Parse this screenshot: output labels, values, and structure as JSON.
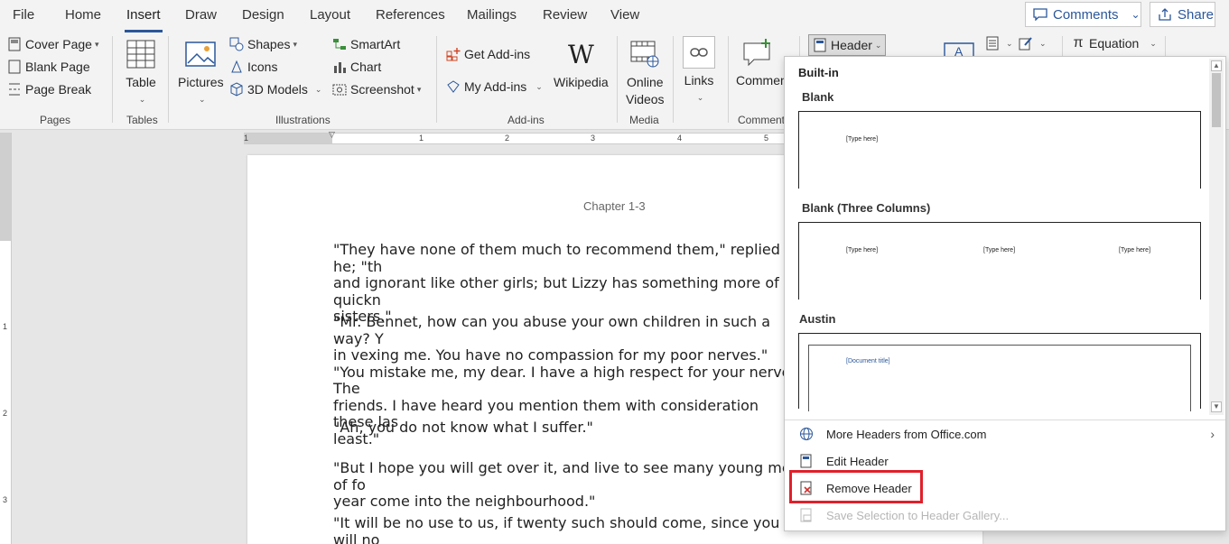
{
  "tabs": [
    "File",
    "Home",
    "Insert",
    "Draw",
    "Design",
    "Layout",
    "References",
    "Mailings",
    "Review",
    "View"
  ],
  "active_tab": "Insert",
  "top_buttons": {
    "comments": "Comments",
    "share": "Share"
  },
  "ribbon": {
    "pages": {
      "cover_page": "Cover Page",
      "blank_page": "Blank Page",
      "page_break": "Page Break",
      "label": "Pages"
    },
    "tables": {
      "table": "Table",
      "label": "Tables"
    },
    "illustrations": {
      "pictures": "Pictures",
      "shapes": "Shapes",
      "icons": "Icons",
      "models": "3D Models",
      "smartart": "SmartArt",
      "chart": "Chart",
      "screenshot": "Screenshot",
      "label": "Illustrations"
    },
    "addins": {
      "get": "Get Add-ins",
      "my": "My Add-ins",
      "wikipedia": "Wikipedia",
      "label": "Add-ins"
    },
    "media": {
      "online1": "Online",
      "online2": "Videos",
      "label": "Media"
    },
    "links": {
      "links": "Links"
    },
    "comments": {
      "comment": "Comment",
      "label": "Comment"
    },
    "header_button": "Header",
    "equation": "Equation"
  },
  "ruler": {
    "h": [
      "1",
      "1",
      "2",
      "3",
      "4",
      "5"
    ],
    "v": [
      "1",
      "2",
      "3"
    ]
  },
  "document": {
    "chapter": "Chapter 1-3",
    "paragraphs": [
      "\"They have none of them much to recommend them,\" replied he; \"th\nand ignorant like other girls; but Lizzy has something more of quickn\nsisters.\"",
      "\"Mr. Bennet, how can you abuse your own children in such a way? Y\nin vexing me. You have no compassion for my poor nerves.\"\n\"You mistake me, my dear. I have a high respect for your nerves. The\nfriends. I have heard you mention them with consideration these las\nleast.\"",
      "\"Ah, you do not know what I suffer.\"",
      "\"But I hope you will get over it, and live to see many young men of fo\nyear come into the neighbourhood.\"",
      "\"It will be no use to us, if twenty such should come, since you will no"
    ]
  },
  "gallery": {
    "title": "Built-in",
    "sections": [
      {
        "name": "Blank",
        "placeholders": [
          "[Type here]"
        ]
      },
      {
        "name": "Blank (Three Columns)",
        "placeholders": [
          "[Type here]",
          "[Type here]",
          "[Type here]"
        ]
      },
      {
        "name": "Austin",
        "placeholders": [
          "[Document title]"
        ]
      }
    ],
    "menu": [
      {
        "label": "More Headers from Office.com",
        "icon": "globe-icon"
      },
      {
        "label": "Edit Header",
        "icon": "edit-header-icon"
      },
      {
        "label": "Remove Header",
        "icon": "remove-header-icon"
      },
      {
        "label": "Save Selection to Header Gallery...",
        "icon": "save-gallery-icon"
      }
    ]
  },
  "colors": {
    "accent": "#2b579a",
    "highlight": "#e0202a"
  }
}
